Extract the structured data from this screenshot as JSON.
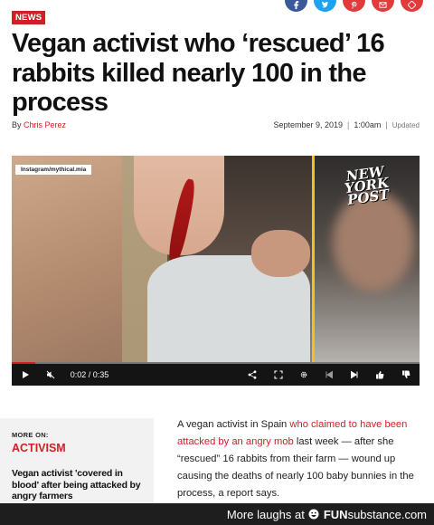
{
  "share": {
    "buttons": [
      {
        "name": "facebook-share-button",
        "color": "#3b5998"
      },
      {
        "name": "twitter-share-button",
        "color": "#1da1f2"
      },
      {
        "name": "pinterest-share-button",
        "color": "#e23b3b"
      },
      {
        "name": "email-share-button",
        "color": "#e23b3b"
      },
      {
        "name": "more-share-button",
        "color": "#e23b3b"
      }
    ]
  },
  "article": {
    "category": "NEWS",
    "headline": "Vegan activist who ‘rescued’ 16 rabbits killed nearly 100 in the process",
    "by_label": "By",
    "author": "Chris Perez",
    "date": "September 9, 2019",
    "time": "1:00am",
    "sep": "|",
    "updated_label": "Updated",
    "body": {
      "before_link": "A vegan activist in Spain ",
      "link": "who claimed to have been attacked by an angry mob",
      "after_link": " last week — after she “rescued” 16 rabbits from their farm — wound up causing the deaths of nearly 100 baby bunnies in the process, a report says."
    }
  },
  "video": {
    "watermark": "Instagram/mythical.mia",
    "logo_line1": "NEW",
    "logo_line2": "YORK",
    "logo_line3": "POST",
    "current_time": "0:02",
    "time_sep": "/",
    "duration": "0:35",
    "progress": 0.057
  },
  "sidebar": {
    "more_on": "MORE ON:",
    "topic": "ACTIVISM",
    "related_title": "Vegan activist 'covered in blood' after being attacked by angry farmers"
  },
  "footer": {
    "prefix": "More laughs at",
    "brand_fun": "FUN",
    "brand_rest": "substance",
    "brand_tld": ".com"
  },
  "colors": {
    "accent": "#d21e26",
    "video_divider": "#f2c21a"
  }
}
